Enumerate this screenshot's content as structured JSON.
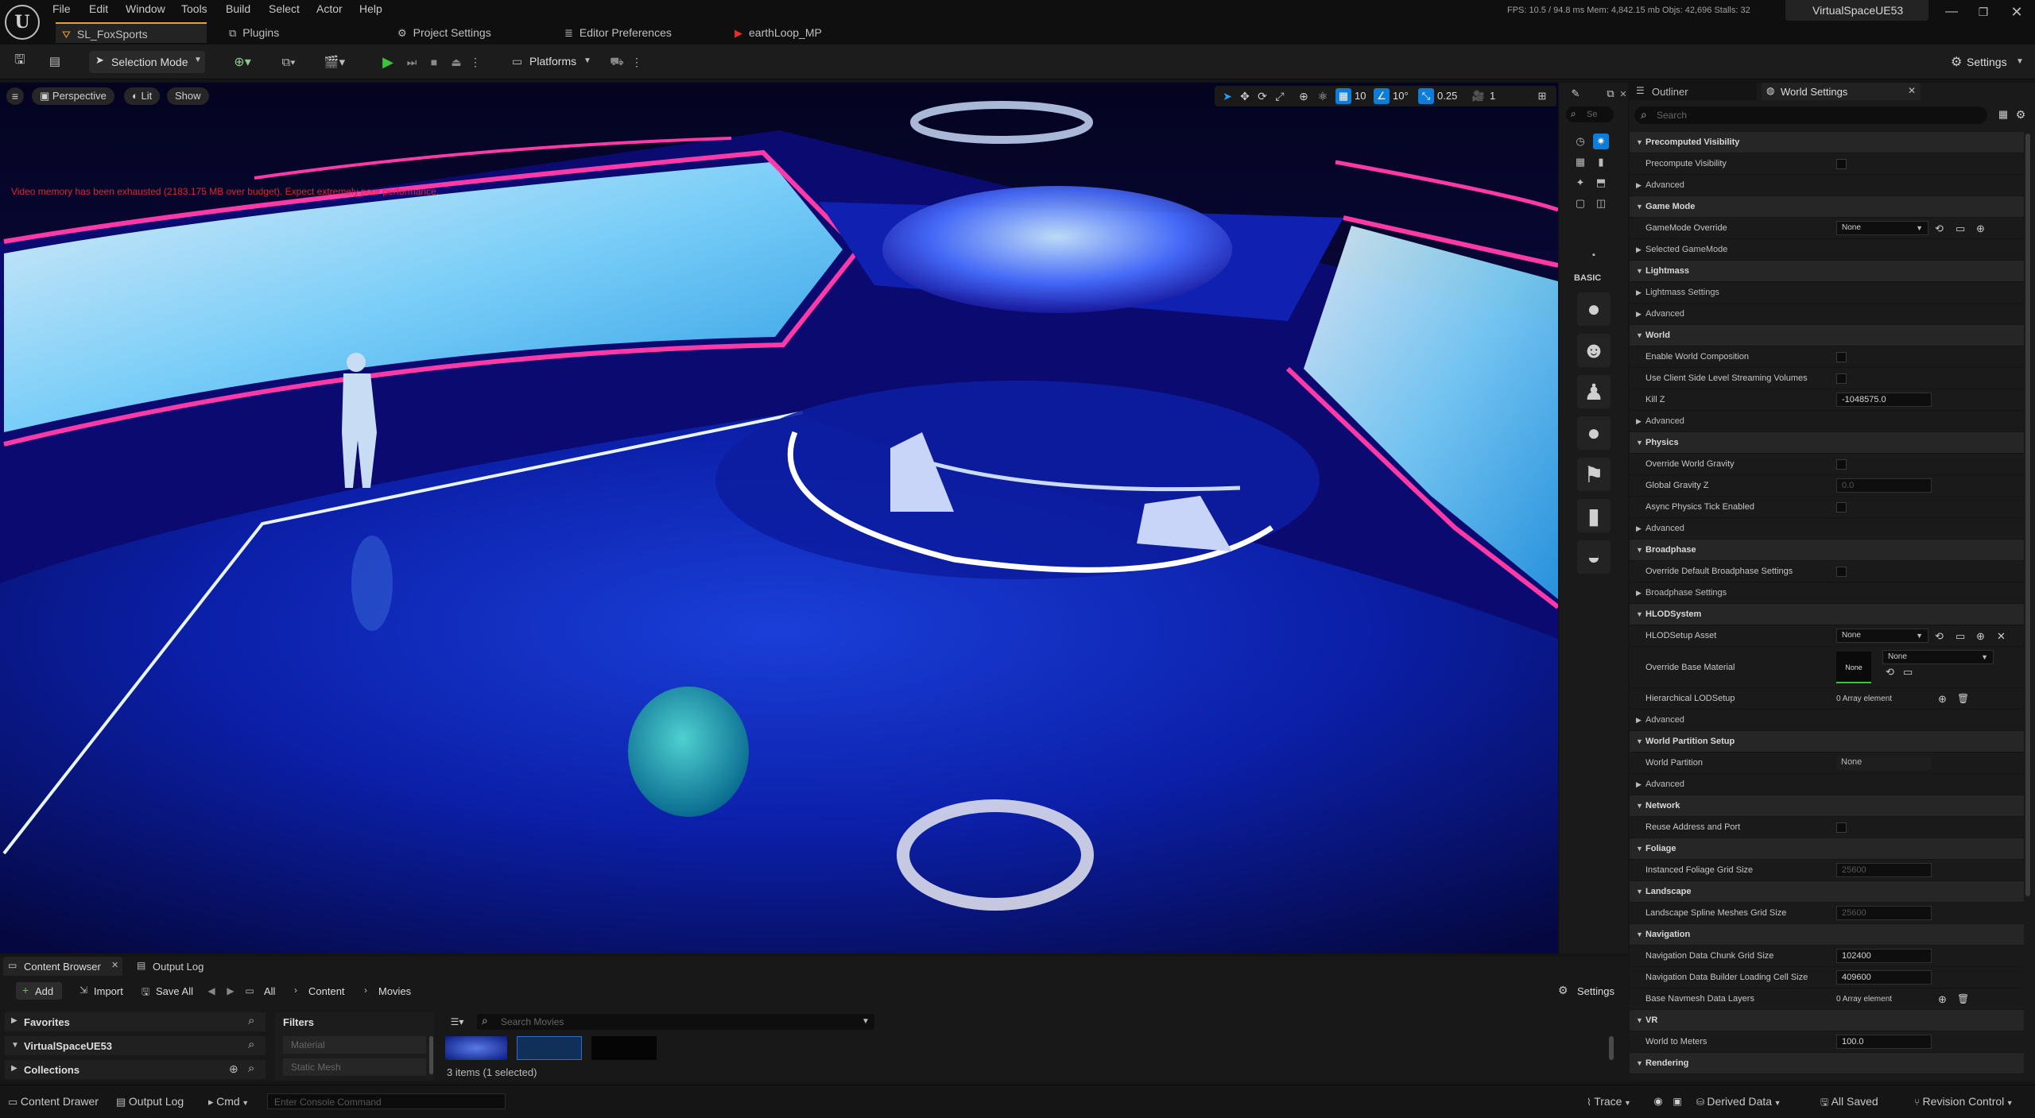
{
  "title_bar": {
    "menus": [
      "File",
      "Edit",
      "Window",
      "Tools",
      "Build",
      "Select",
      "Actor",
      "Help"
    ],
    "stats": "FPS: 10.5 / 94.8 ms  Mem: 4,842.15 mb  Objs: 42,696  Stalls: 32",
    "project_name": "VirtualSpaceUE53",
    "tabs": [
      {
        "label": "SL_FoxSports",
        "icon": "level-icon"
      },
      {
        "label": "Plugins",
        "icon": "plugin-icon"
      },
      {
        "label": "Project Settings",
        "icon": "gear-icon"
      },
      {
        "label": "Editor Preferences",
        "icon": "sliders-icon"
      },
      {
        "label": "earthLoop_MP",
        "icon": "media-player-icon"
      }
    ]
  },
  "toolbar": {
    "selection_mode": "Selection Mode",
    "platforms": "Platforms",
    "settings": "Settings"
  },
  "viewport": {
    "perspective": "Perspective",
    "lit": "Lit",
    "show": "Show",
    "warning": "Video memory has been exhausted (2183.175 MB over budget). Expect extremely poor performance.",
    "grid_snap": "10",
    "rotation_snap": "10°",
    "scale_snap": "0.25",
    "camera_speed": "1"
  },
  "place_actors": {
    "search_placeholder": "Se",
    "category": "BASIC"
  },
  "outliner_tab": "Outliner",
  "world_settings_tab": "World Settings",
  "details_search_placeholder": "Search",
  "details": [
    {
      "type": "cat",
      "label": "Precomputed Visibility"
    },
    {
      "type": "prop",
      "label": "Precompute Visibility",
      "control": "check"
    },
    {
      "type": "sub",
      "label": "Advanced"
    },
    {
      "type": "cat",
      "label": "Game Mode"
    },
    {
      "type": "prop",
      "label": "GameMode Override",
      "control": "dropdown",
      "value": "None"
    },
    {
      "type": "sub",
      "label": "Selected GameMode"
    },
    {
      "type": "cat",
      "label": "Lightmass"
    },
    {
      "type": "sub",
      "label": "Lightmass Settings"
    },
    {
      "type": "sub",
      "label": "Advanced"
    },
    {
      "type": "cat",
      "label": "World"
    },
    {
      "type": "prop",
      "label": "Enable World Composition",
      "control": "check"
    },
    {
      "type": "prop",
      "label": "Use Client Side Level Streaming Volumes",
      "control": "check"
    },
    {
      "type": "prop",
      "label": "Kill Z",
      "control": "number",
      "value": "-1048575.0"
    },
    {
      "type": "sub",
      "label": "Advanced"
    },
    {
      "type": "cat",
      "label": "Physics"
    },
    {
      "type": "prop",
      "label": "Override World Gravity",
      "control": "check"
    },
    {
      "type": "prop",
      "label": "Global Gravity Z",
      "control": "number_disabled",
      "value": "0.0"
    },
    {
      "type": "prop",
      "label": "Async Physics Tick Enabled",
      "control": "check"
    },
    {
      "type": "sub",
      "label": "Advanced"
    },
    {
      "type": "cat",
      "label": "Broadphase"
    },
    {
      "type": "prop",
      "label": "Override Default Broadphase Settings",
      "control": "check"
    },
    {
      "type": "sub",
      "label": "Broadphase Settings"
    },
    {
      "type": "cat",
      "label": "HLODSystem"
    },
    {
      "type": "prop",
      "label": "HLODSetup Asset",
      "control": "dropdown",
      "value": "None"
    },
    {
      "type": "prop_tall",
      "label": "Override Base Material",
      "value": "None",
      "thumb": "None"
    },
    {
      "type": "prop",
      "label": "Hierarchical LODSetup",
      "control": "array",
      "value": "0 Array element"
    },
    {
      "type": "sub",
      "label": "Advanced"
    },
    {
      "type": "cat",
      "label": "World Partition Setup"
    },
    {
      "type": "prop",
      "label": "World Partition",
      "control": "flat",
      "value": "None"
    },
    {
      "type": "sub",
      "label": "Advanced"
    },
    {
      "type": "cat",
      "label": "Network"
    },
    {
      "type": "prop",
      "label": "Reuse Address and Port",
      "control": "check"
    },
    {
      "type": "cat",
      "label": "Foliage"
    },
    {
      "type": "prop",
      "label": "Instanced Foliage Grid Size",
      "control": "number_disabled",
      "value": "25600"
    },
    {
      "type": "cat",
      "label": "Landscape"
    },
    {
      "type": "prop",
      "label": "Landscape Spline Meshes Grid Size",
      "control": "number_disabled",
      "value": "25600"
    },
    {
      "type": "cat",
      "label": "Navigation"
    },
    {
      "type": "prop",
      "label": "Navigation Data Chunk Grid Size",
      "control": "number",
      "value": "102400"
    },
    {
      "type": "prop",
      "label": "Navigation Data Builder Loading Cell Size",
      "control": "number",
      "value": "409600"
    },
    {
      "type": "prop",
      "label": "Base Navmesh Data Layers",
      "control": "array",
      "value": "0 Array element"
    },
    {
      "type": "cat",
      "label": "VR"
    },
    {
      "type": "prop",
      "label": "World to Meters",
      "control": "number",
      "value": "100.0"
    },
    {
      "type": "cat",
      "label": "Rendering"
    }
  ],
  "content_browser": {
    "tab": "Content Browser",
    "output_tab": "Output Log",
    "add": "Add",
    "import": "Import",
    "save_all": "Save All",
    "breadcrumb": [
      "All",
      "Content",
      "Movies"
    ],
    "settings": "Settings",
    "favorites": "Favorites",
    "project": "VirtualSpaceUE53",
    "collections": "Collections",
    "filters": "Filters",
    "filter_items": [
      "Material",
      "Static Mesh"
    ],
    "search_placeholder": "Search Movies",
    "count": "3 items (1 selected)"
  },
  "status_bar": {
    "content_drawer": "Content Drawer",
    "output_log": "Output Log",
    "cmd": "Cmd",
    "console_placeholder": "Enter Console Command",
    "trace": "Trace",
    "derived_data": "Derived Data",
    "all_saved": "All Saved",
    "revision_control": "Revision Control"
  },
  "colors": {
    "accent": "#0e7dd8",
    "warning": "#e0262a",
    "neon_pink": "#ff3aa8",
    "play_green": "#3cc43c"
  }
}
